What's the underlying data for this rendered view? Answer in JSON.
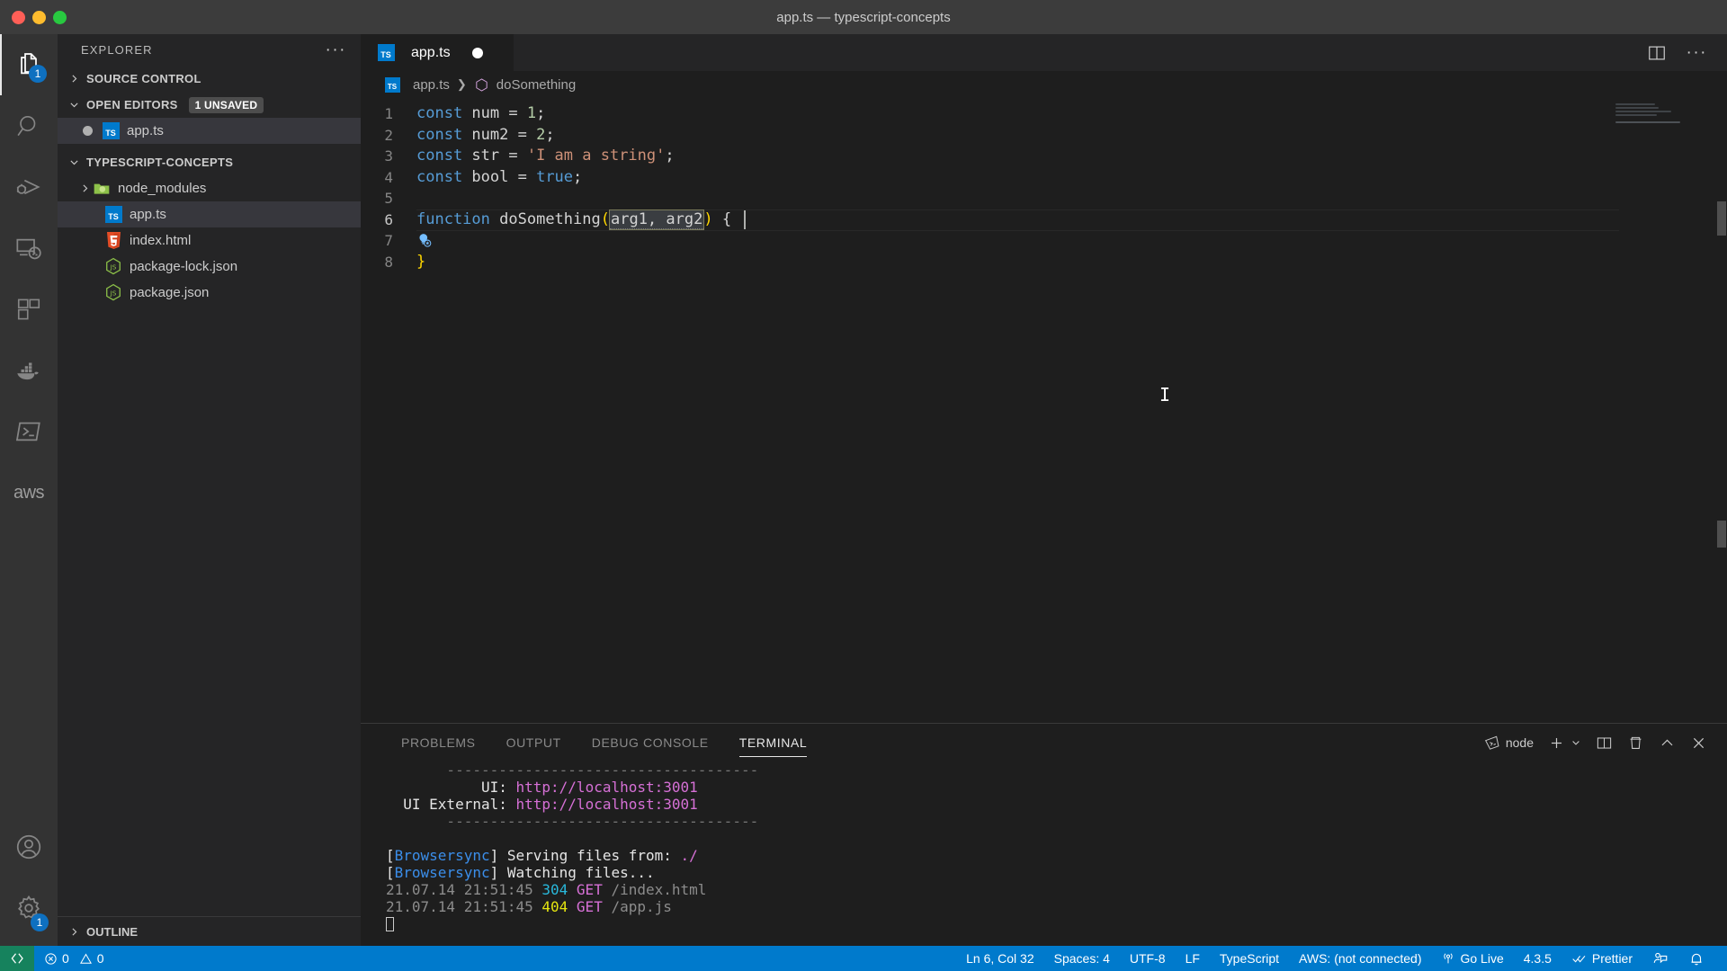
{
  "window": {
    "title": "app.ts — typescript-concepts"
  },
  "activitybar": {
    "items": [
      {
        "name": "explorer",
        "icon": "files-icon",
        "badge": "1",
        "active": true
      },
      {
        "name": "search",
        "icon": "search-icon",
        "badge": ""
      },
      {
        "name": "run-and-debug",
        "icon": "debug-icon",
        "badge": ""
      },
      {
        "name": "remote-explorer",
        "icon": "remote-icon",
        "badge": ""
      },
      {
        "name": "extensions",
        "icon": "extensions-icon",
        "badge": ""
      },
      {
        "name": "docker",
        "icon": "docker-icon",
        "badge": ""
      },
      {
        "name": "terminal-powershell",
        "icon": "powershell-icon",
        "badge": ""
      },
      {
        "name": "aws-toolkit",
        "icon": "aws-icon",
        "label": "aws",
        "badge": ""
      }
    ],
    "bottom": [
      {
        "name": "accounts",
        "icon": "account-icon",
        "badge": ""
      },
      {
        "name": "manage-settings",
        "icon": "gear-icon",
        "badge": "1"
      }
    ]
  },
  "sidebar": {
    "title": "EXPLORER",
    "more_label": "···",
    "sections": {
      "source_control": {
        "label": "SOURCE CONTROL",
        "expanded": false
      },
      "open_editors": {
        "label": "OPEN EDITORS",
        "badge": "1 UNSAVED",
        "expanded": true,
        "items": [
          {
            "label": "app.ts",
            "icon": "typescript-file-icon",
            "dirty": true,
            "selected": true
          }
        ]
      },
      "project": {
        "label": "TYPESCRIPT-CONCEPTS",
        "expanded": true,
        "items": [
          {
            "label": "node_modules",
            "icon": "folder-icon",
            "type": "folder",
            "expanded": false
          },
          {
            "label": "app.ts",
            "icon": "typescript-file-icon",
            "type": "file",
            "selected": true
          },
          {
            "label": "index.html",
            "icon": "html-file-icon",
            "type": "file"
          },
          {
            "label": "package-lock.json",
            "icon": "nodejs-file-icon",
            "type": "file"
          },
          {
            "label": "package.json",
            "icon": "nodejs-file-icon",
            "type": "file"
          }
        ]
      },
      "outline": {
        "label": "OUTLINE",
        "expanded": false
      }
    }
  },
  "editor": {
    "tabs": [
      {
        "label": "app.ts",
        "icon": "typescript-file-icon",
        "dirty": true,
        "active": true
      }
    ],
    "actions": [
      {
        "name": "split-editor-icon"
      },
      {
        "name": "more-actions-icon",
        "label": "···"
      }
    ],
    "breadcrumb": [
      {
        "label": "app.ts",
        "icon": "typescript-file-icon"
      },
      {
        "label": "doSomething",
        "icon": "symbol-function-icon"
      }
    ],
    "lines": [
      {
        "n": "1",
        "tokens": [
          {
            "t": "const ",
            "c": "kw"
          },
          {
            "t": "num ",
            "c": "plain"
          },
          {
            "t": "= ",
            "c": "plain"
          },
          {
            "t": "1",
            "c": "num"
          },
          {
            "t": ";",
            "c": "plain"
          }
        ]
      },
      {
        "n": "2",
        "tokens": [
          {
            "t": "const ",
            "c": "kw"
          },
          {
            "t": "num2 ",
            "c": "plain"
          },
          {
            "t": "= ",
            "c": "plain"
          },
          {
            "t": "2",
            "c": "num"
          },
          {
            "t": ";",
            "c": "plain"
          }
        ]
      },
      {
        "n": "3",
        "tokens": [
          {
            "t": "const ",
            "c": "kw"
          },
          {
            "t": "str ",
            "c": "plain"
          },
          {
            "t": "= ",
            "c": "plain"
          },
          {
            "t": "'I am a string'",
            "c": "str"
          },
          {
            "t": ";",
            "c": "plain"
          }
        ]
      },
      {
        "n": "4",
        "tokens": [
          {
            "t": "const ",
            "c": "kw"
          },
          {
            "t": "bool ",
            "c": "plain"
          },
          {
            "t": "= ",
            "c": "plain"
          },
          {
            "t": "true",
            "c": "kw"
          },
          {
            "t": ";",
            "c": "plain"
          }
        ]
      },
      {
        "n": "5",
        "tokens": [],
        "lightbulb": true
      },
      {
        "n": "6",
        "current": true,
        "tokens": [
          {
            "t": "function ",
            "c": "kw"
          },
          {
            "t": "doSomething",
            "c": "plain"
          },
          {
            "t": "(",
            "c": "paren-y"
          },
          {
            "t": "arg1, arg2",
            "c": "selected"
          },
          {
            "t": ")",
            "c": "paren-y"
          },
          {
            "t": " {",
            "c": "plain"
          }
        ]
      },
      {
        "n": "7",
        "tokens": []
      },
      {
        "n": "8",
        "tokens": [
          {
            "t": "}",
            "c": "paren-y"
          }
        ]
      }
    ]
  },
  "panel": {
    "tabs": [
      {
        "label": "PROBLEMS",
        "active": false
      },
      {
        "label": "OUTPUT",
        "active": false
      },
      {
        "label": "DEBUG CONSOLE",
        "active": false
      },
      {
        "label": "TERMINAL",
        "active": true
      }
    ],
    "actions": {
      "shell_label": "node",
      "shell_icon": "terminal-shell-icon",
      "new_terminal_icon": "plus-icon",
      "dropdown_icon": "chevron-down-icon",
      "split_icon": "split-terminal-icon",
      "kill_icon": "trash-icon",
      "maximize_icon": "chevron-up-icon",
      "close_icon": "close-icon"
    },
    "terminal_lines": [
      {
        "segments": [
          {
            "t": "       ------------------------------------",
            "c": "t-sep"
          }
        ]
      },
      {
        "segments": [
          {
            "t": "           UI: ",
            "c": "t-white"
          },
          {
            "t": "http://localhost:3001",
            "c": "t-magenta"
          }
        ]
      },
      {
        "segments": [
          {
            "t": "  UI External: ",
            "c": "t-white"
          },
          {
            "t": "http://localhost:3001",
            "c": "t-magenta"
          }
        ]
      },
      {
        "segments": [
          {
            "t": "       ------------------------------------",
            "c": "t-sep"
          }
        ]
      },
      {
        "segments": []
      },
      {
        "segments": [
          {
            "t": "[",
            "c": "t-white"
          },
          {
            "t": "Browsersync",
            "c": "t-blue"
          },
          {
            "t": "] Serving files from: ",
            "c": "t-white"
          },
          {
            "t": "./",
            "c": "t-magenta"
          }
        ]
      },
      {
        "segments": [
          {
            "t": "[",
            "c": "t-white"
          },
          {
            "t": "Browsersync",
            "c": "t-blue"
          },
          {
            "t": "] Watching files...",
            "c": "t-white"
          }
        ]
      },
      {
        "segments": [
          {
            "t": "21.07.14 21:51:45 ",
            "c": "t-dim"
          },
          {
            "t": "304 ",
            "c": "t-cyan"
          },
          {
            "t": "GET ",
            "c": "t-magenta"
          },
          {
            "t": "/index.html",
            "c": "t-dim"
          }
        ]
      },
      {
        "segments": [
          {
            "t": "21.07.14 21:51:45 ",
            "c": "t-dim"
          },
          {
            "t": "404 ",
            "c": "t-yellow"
          },
          {
            "t": "GET ",
            "c": "t-magenta"
          },
          {
            "t": "/app.js",
            "c": "t-dim"
          }
        ]
      },
      {
        "segments": [],
        "cursor": true
      }
    ]
  },
  "statusbar": {
    "remote_icon": "remote-host-icon",
    "left": [
      {
        "name": "problems",
        "icon": "error-warning-icon",
        "errors": "0",
        "warnings": "0"
      }
    ],
    "right": [
      {
        "name": "cursor-position",
        "label": "Ln 6, Col 32"
      },
      {
        "name": "indentation",
        "label": "Spaces: 4"
      },
      {
        "name": "encoding",
        "label": "UTF-8"
      },
      {
        "name": "eol",
        "label": "LF"
      },
      {
        "name": "language-mode",
        "label": "TypeScript"
      },
      {
        "name": "aws-connection",
        "label": "AWS: (not connected)"
      },
      {
        "name": "go-live",
        "label": "Go Live",
        "icon": "broadcast-icon"
      },
      {
        "name": "version",
        "label": "4.3.5"
      },
      {
        "name": "prettier",
        "label": "Prettier",
        "icon": "checks-icon"
      },
      {
        "name": "feedback",
        "label": "",
        "icon": "feedback-icon"
      },
      {
        "name": "notifications",
        "label": "",
        "icon": "bell-icon"
      }
    ]
  },
  "colors": {
    "accent": "#007acc",
    "remote_green": "#16825d",
    "badge_blue": "#0e70c0",
    "editor_bg": "#1e1e1e",
    "sidebar_bg": "#252526",
    "activitybar_bg": "#333333"
  }
}
